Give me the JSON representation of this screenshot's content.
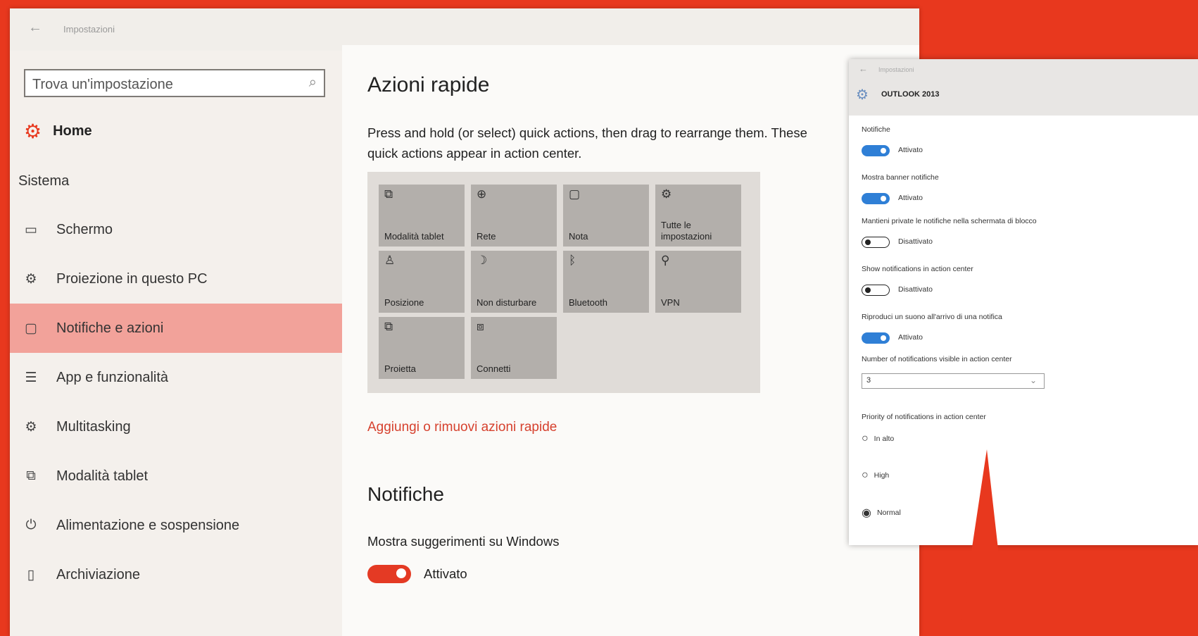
{
  "window": {
    "title": "Impostazioni",
    "back_icon": "back-arrow-icon"
  },
  "search": {
    "placeholder": "Trova un'impostazione"
  },
  "home": {
    "label": "Home"
  },
  "sidebar": {
    "section": "Sistema",
    "items": [
      {
        "label": "Schermo",
        "icon": "monitor-icon",
        "glyph": "▭"
      },
      {
        "label": "Proiezione in questo PC",
        "icon": "gear-icon",
        "glyph": "⚙"
      },
      {
        "label": "Notifiche e azioni",
        "icon": "notification-icon",
        "glyph": "▢",
        "active": true
      },
      {
        "label": "App e funzionalità",
        "icon": "list-icon",
        "glyph": "☰"
      },
      {
        "label": "Multitasking",
        "icon": "gear-icon",
        "glyph": "⚙"
      },
      {
        "label": "Modalità tablet",
        "icon": "tablet-icon",
        "glyph": "⧉"
      },
      {
        "label": "Alimentazione e sospensione",
        "icon": "power-icon",
        "glyph": "⏻"
      },
      {
        "label": "Archiviazione",
        "icon": "storage-icon",
        "glyph": "▯"
      }
    ]
  },
  "main": {
    "title": "Azioni rapide",
    "description": "Press and hold (or select) quick actions, then drag to rearrange them. These quick actions appear in action center.",
    "tiles": [
      {
        "label": "Modalità tablet",
        "icon": "tablet-icon",
        "glyph": "⧉"
      },
      {
        "label": "Rete",
        "icon": "globe-icon",
        "glyph": "⊕"
      },
      {
        "label": "Nota",
        "icon": "note-icon",
        "glyph": "▢"
      },
      {
        "label": "Tutte le impostazioni",
        "icon": "gear-icon",
        "glyph": "⚙"
      },
      {
        "label": "Posizione",
        "icon": "location-icon",
        "glyph": "♙"
      },
      {
        "label": "Non disturbare",
        "icon": "moon-icon",
        "glyph": "☽"
      },
      {
        "label": "Bluetooth",
        "icon": "bluetooth-icon",
        "glyph": "ᛒ"
      },
      {
        "label": "VPN",
        "icon": "vpn-icon",
        "glyph": "⚲"
      },
      {
        "label": "Proietta",
        "icon": "project-icon",
        "glyph": "⧉"
      },
      {
        "label": "Connetti",
        "icon": "connect-icon",
        "glyph": "⧈"
      }
    ],
    "link": "Aggiungi o rimuovi azioni rapide",
    "notifications_title": "Notifiche",
    "setting_label": "Mostra suggerimenti su Windows",
    "setting_state": "Attivato"
  },
  "overlay": {
    "window_title": "Impostazioni",
    "app_title": "OUTLOOK 2013",
    "settings": [
      {
        "label": "Notifiche",
        "state": "Attivato",
        "on": true
      },
      {
        "label": "Mostra banner notifiche",
        "state": "Attivato",
        "on": true
      },
      {
        "label": "Mantieni private le notifiche nella schermata di blocco",
        "state": "Disattivato",
        "on": false
      },
      {
        "label": "Show notifications in action center",
        "state": "Disattivato",
        "on": false
      },
      {
        "label": "Riproduci un suono all'arrivo di una notifica",
        "state": "Attivato",
        "on": true
      }
    ],
    "count_label": "Number of notifications visible in action center",
    "count_value": "3",
    "priority_label": "Priority of notifications in action center",
    "priority_options": [
      {
        "label": "In alto",
        "selected": false
      },
      {
        "label": "High",
        "selected": false
      },
      {
        "label": "Normal",
        "selected": true
      }
    ]
  },
  "colors": {
    "accent": "#e8381e",
    "toggle_on": "#e43a24",
    "overlay_toggle_on": "#2f7fd6",
    "active_item_bg": "#f2a29a"
  }
}
